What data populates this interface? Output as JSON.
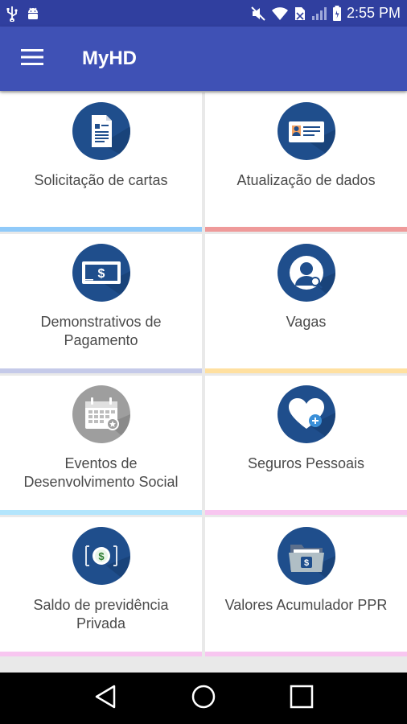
{
  "status_bar": {
    "time": "2:55 PM",
    "icons": [
      "usb-icon",
      "android-icon",
      "mute-icon",
      "wifi-icon",
      "no-sim-icon",
      "signal-icon",
      "battery-icon"
    ]
  },
  "app_bar": {
    "title": "MyHD",
    "menu_icon": "hamburger-menu-icon"
  },
  "tiles": [
    {
      "label": "Solicitação de cartas",
      "icon": "document-icon",
      "accent": "#90caf9",
      "circle": "#1f4e8c"
    },
    {
      "label": "Atualização de dados",
      "icon": "id-card-icon",
      "accent": "#ef9a9a",
      "circle": "#1f4e8c"
    },
    {
      "label": "Demonstrativos de\nPagamento",
      "icon": "payslip-icon",
      "accent": "#c5cae9",
      "circle": "#1f4e8c"
    },
    {
      "label": "Vagas",
      "icon": "job-search-icon",
      "accent": "#ffe0a0",
      "circle": "#1f4e8c"
    },
    {
      "label": "Eventos de\nDesenvolvimento Social",
      "icon": "calendar-icon",
      "accent": "#b3e5fc",
      "circle": "#9e9e9e"
    },
    {
      "label": "Seguros Pessoais",
      "icon": "heart-plus-icon",
      "accent": "#f8c6f0",
      "circle": "#1f4e8c"
    },
    {
      "label": "Saldo de previdência\nPrivada",
      "icon": "coin-icon",
      "accent": "#f8c6f0",
      "circle": "#1f4e8c"
    },
    {
      "label": "Valores Acumulador PPR",
      "icon": "money-folder-icon",
      "accent": "#f8c6f0",
      "circle": "#1f4e8c"
    }
  ],
  "nav_bar": {
    "icons": [
      "back-icon",
      "home-icon",
      "recents-icon"
    ]
  }
}
